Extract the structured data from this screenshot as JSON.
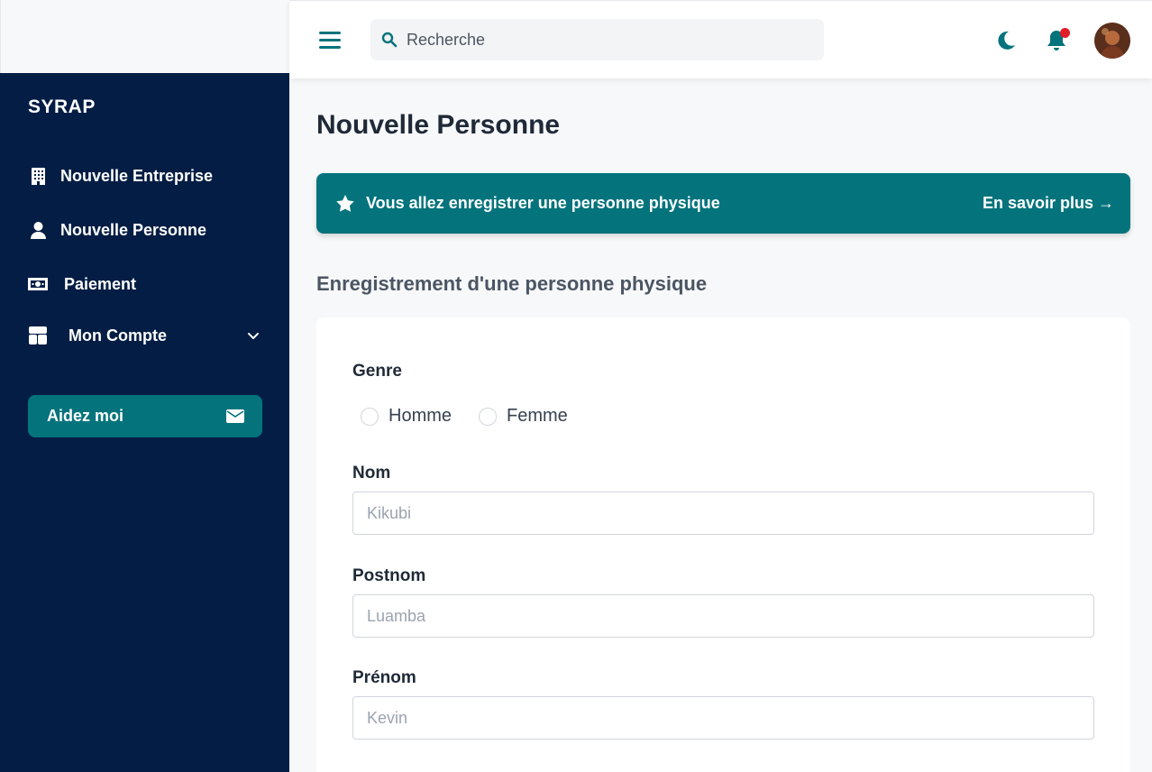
{
  "sidebar": {
    "brand": "SYRAP",
    "items": [
      {
        "label": "Nouvelle Entreprise",
        "icon": "building-icon"
      },
      {
        "label": "Nouvelle Personne",
        "icon": "user-icon"
      },
      {
        "label": "Paiement",
        "icon": "money-icon"
      },
      {
        "label": "Mon Compte",
        "icon": "layout-icon"
      }
    ],
    "help_label": "Aidez moi"
  },
  "header": {
    "search_placeholder": "Recherche"
  },
  "main": {
    "page_title": "Nouvelle Personne",
    "banner": {
      "text": "Vous allez enregistrer une personne physique",
      "link": "En savoir plus →"
    },
    "section_title": "Enregistrement d'une personne physique",
    "form": {
      "genre_label": "Genre",
      "genre_options": [
        "Homme",
        "Femme"
      ],
      "nom_label": "Nom",
      "nom_placeholder": "Kikubi",
      "postnom_label": "Postnom",
      "postnom_placeholder": "Luamba",
      "prenom_label": "Prénom",
      "prenom_placeholder": "Kevin"
    }
  },
  "colors": {
    "sidebar_bg": "#031d44",
    "accent": "#04737c",
    "notification_dot": "#e11d2a"
  }
}
